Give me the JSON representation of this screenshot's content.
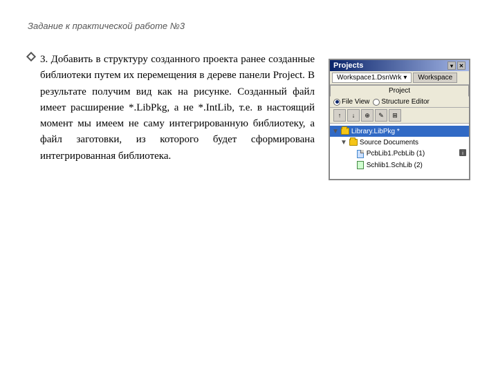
{
  "slide": {
    "title": "Задание к практической работе №3",
    "bullet": {
      "text": "3.  Добавить  в  структуру созданного  проекта  ранее созданные  библиотеки  путем их  перемещения  в  дереве панели  Project.  В  результате получим  вид  как  на  рисунке. Созданный  файл  имеет расширение  *.LibPkg,  а  не *.IntLib,  т.е.  в  настоящий момент  мы  имеем  не  саму интегрированную  библиотеку, а  файл  заготовки,  из  которого будет       сформирована интегрированная библиотека."
    }
  },
  "panel": {
    "title": "Projects",
    "controls": [
      "▾",
      "✕"
    ],
    "workspace_tabs": [
      "Workspace1.DsnWrk ▾",
      "Workspace"
    ],
    "project_tab": "Project",
    "view_options": [
      "File View",
      "Structure Editor"
    ],
    "toolbar_buttons": [
      "↑",
      "↓",
      "⊕",
      "✎",
      "⊞"
    ],
    "tree": [
      {
        "label": "Library.LibPkg *",
        "type": "root",
        "expanded": true,
        "selected": true,
        "indent": 0
      },
      {
        "label": "Source Documents",
        "type": "folder",
        "expanded": true,
        "selected": false,
        "indent": 1
      },
      {
        "label": "PcbLib1.PcbLib (1)",
        "type": "pcblib",
        "selected": false,
        "indent": 2
      },
      {
        "label": "Schlib1.SchLib (2)",
        "type": "schlib",
        "selected": false,
        "indent": 2
      }
    ]
  }
}
